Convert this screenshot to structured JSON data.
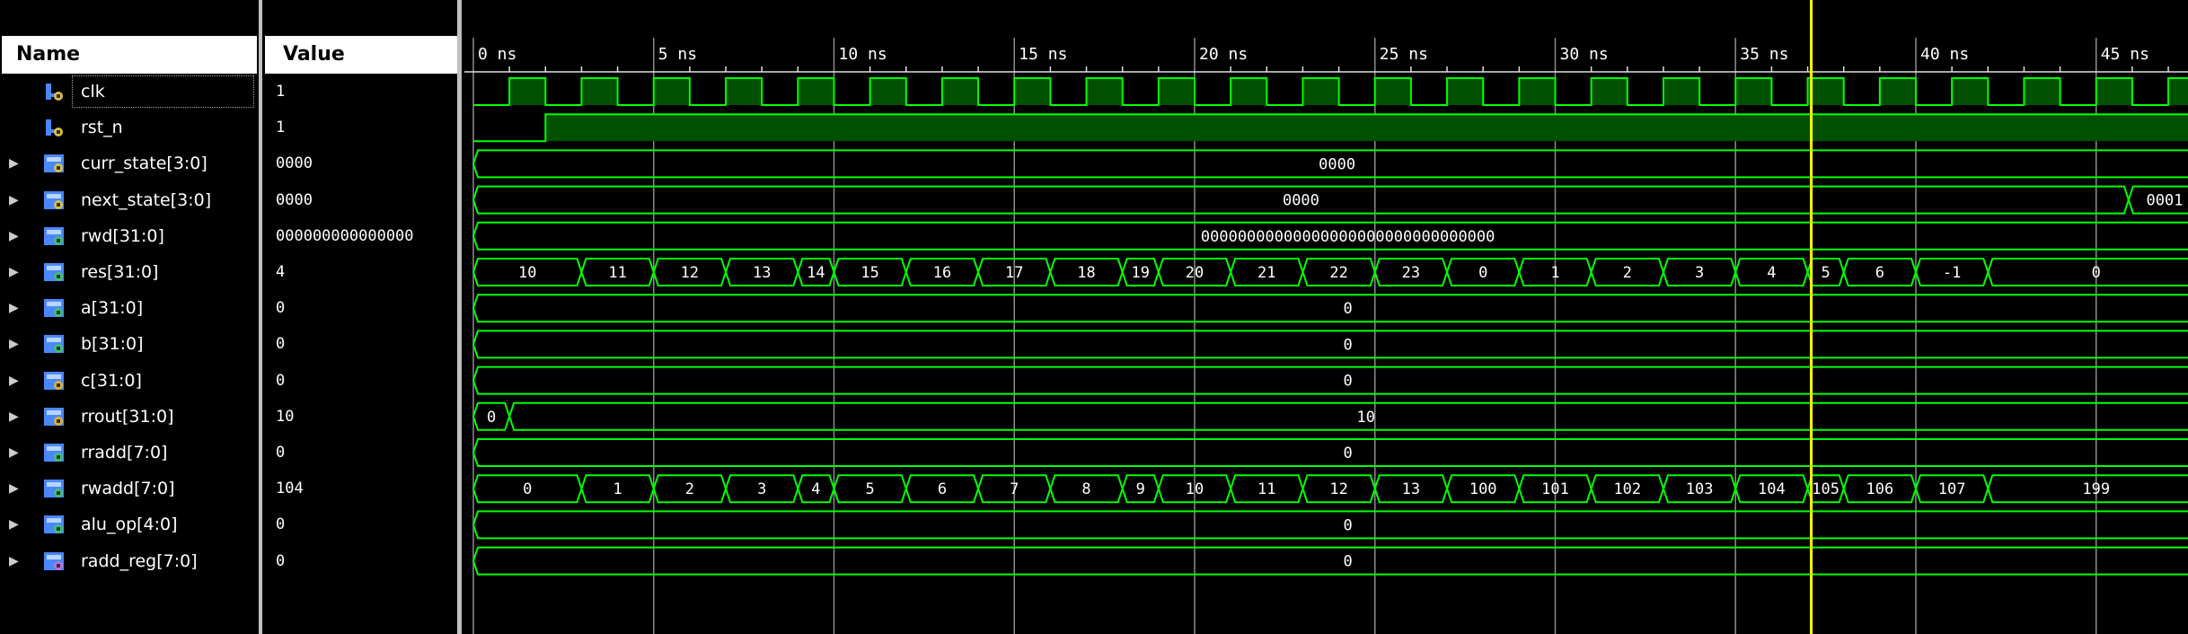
{
  "columns": {
    "name": "Name",
    "value": "Value"
  },
  "colors": {
    "wave": "#00ff00",
    "fill": "#005000",
    "cursor": "#ffff00",
    "grid": "#8c8c8c",
    "background": "#000000"
  },
  "timeline": {
    "ticks": [
      {
        "t": 0,
        "label": "0 ns"
      },
      {
        "t": 5,
        "label": "5 ns"
      },
      {
        "t": 10,
        "label": "10 ns"
      },
      {
        "t": 15,
        "label": "15 ns"
      },
      {
        "t": 20,
        "label": "20 ns"
      },
      {
        "t": 25,
        "label": "25 ns"
      },
      {
        "t": 30,
        "label": "30 ns"
      },
      {
        "t": 35,
        "label": "35 ns"
      },
      {
        "t": 40,
        "label": "40 ns"
      },
      {
        "t": 45,
        "label": "45 ns"
      }
    ],
    "cursor_ns": 37.1
  },
  "signals": [
    {
      "name": "clk",
      "value": "1",
      "kind": "clock",
      "icon": "input-bit-icon",
      "expandable": false,
      "clock": {
        "first_rise": 1,
        "high": 1,
        "low": 1
      }
    },
    {
      "name": "rst_n",
      "value": "1",
      "kind": "bit",
      "icon": "input-bit-icon",
      "expandable": false,
      "edges": [
        {
          "t": 0,
          "v": 0
        },
        {
          "t": 2,
          "v": 1
        }
      ]
    },
    {
      "name": "curr_state[3:0]",
      "value": "0000",
      "kind": "bus",
      "icon": "input-bus-icon",
      "expandable": true,
      "segments": [
        {
          "t0": 0,
          "t1": 47.9,
          "label": "0000"
        }
      ]
    },
    {
      "name": "next_state[3:0]",
      "value": "0000",
      "kind": "bus",
      "icon": "input-bus-icon",
      "expandable": true,
      "segments": [
        {
          "t0": 0,
          "t1": 45.9,
          "label": "0000"
        },
        {
          "t0": 45.9,
          "t1": 47.9,
          "label": "0001"
        }
      ]
    },
    {
      "name": "rwd[31:0]",
      "value": "000000000000000",
      "kind": "bus",
      "icon": "output-bus-icon",
      "expandable": true,
      "segments": [
        {
          "t0": 0,
          "t1": 48.5,
          "label": "00000000000000000000000000000000"
        }
      ]
    },
    {
      "name": "res[31:0]",
      "value": "4",
      "kind": "bus",
      "icon": "output-bus-icon",
      "expandable": true,
      "segments": [
        {
          "t0": 0,
          "t1": 3,
          "label": "10"
        },
        {
          "t0": 3,
          "t1": 5,
          "label": "11"
        },
        {
          "t0": 5,
          "t1": 7,
          "label": "12"
        },
        {
          "t0": 7,
          "t1": 9,
          "label": "13"
        },
        {
          "t0": 9,
          "t1": 10,
          "label": "14"
        },
        {
          "t0": 10,
          "t1": 12,
          "label": "15"
        },
        {
          "t0": 12,
          "t1": 14,
          "label": "16"
        },
        {
          "t0": 14,
          "t1": 16,
          "label": "17"
        },
        {
          "t0": 16,
          "t1": 18,
          "label": "18"
        },
        {
          "t0": 18,
          "t1": 19,
          "label": "19"
        },
        {
          "t0": 19,
          "t1": 21,
          "label": "20"
        },
        {
          "t0": 21,
          "t1": 23,
          "label": "21"
        },
        {
          "t0": 23,
          "t1": 25,
          "label": "22"
        },
        {
          "t0": 25,
          "t1": 27,
          "label": "23"
        },
        {
          "t0": 27,
          "t1": 29,
          "label": "0"
        },
        {
          "t0": 29,
          "t1": 31,
          "label": "1"
        },
        {
          "t0": 31,
          "t1": 33,
          "label": "2"
        },
        {
          "t0": 33,
          "t1": 35,
          "label": "3"
        },
        {
          "t0": 35,
          "t1": 37,
          "label": "4"
        },
        {
          "t0": 37,
          "t1": 38,
          "label": "5"
        },
        {
          "t0": 38,
          "t1": 40,
          "label": "6"
        },
        {
          "t0": 40,
          "t1": 42,
          "label": "-1"
        },
        {
          "t0": 42,
          "t1": 48,
          "label": "0"
        }
      ]
    },
    {
      "name": "a[31:0]",
      "value": "0",
      "kind": "bus",
      "icon": "output-bus-icon",
      "expandable": true,
      "segments": [
        {
          "t0": 0,
          "t1": 48.5,
          "label": "0"
        }
      ]
    },
    {
      "name": "b[31:0]",
      "value": "0",
      "kind": "bus",
      "icon": "output-bus-icon",
      "expandable": true,
      "segments": [
        {
          "t0": 0,
          "t1": 48.5,
          "label": "0"
        }
      ]
    },
    {
      "name": "c[31:0]",
      "value": "0",
      "kind": "bus",
      "icon": "internal-bus-icon",
      "expandable": true,
      "segments": [
        {
          "t0": 0,
          "t1": 48.5,
          "label": "0"
        }
      ]
    },
    {
      "name": "rrout[31:0]",
      "value": "10",
      "kind": "bus",
      "icon": "internal-bus-icon",
      "expandable": true,
      "segments": [
        {
          "t0": 0,
          "t1": 1,
          "label": "0"
        },
        {
          "t0": 1,
          "t1": 48.5,
          "label": "10"
        }
      ]
    },
    {
      "name": "rradd[7:0]",
      "value": "0",
      "kind": "bus",
      "icon": "output-bus-icon",
      "expandable": true,
      "segments": [
        {
          "t0": 0,
          "t1": 48.5,
          "label": "0"
        }
      ]
    },
    {
      "name": "rwadd[7:0]",
      "value": "104",
      "kind": "bus",
      "icon": "output-bus-icon",
      "expandable": true,
      "segments": [
        {
          "t0": 0,
          "t1": 3,
          "label": "0"
        },
        {
          "t0": 3,
          "t1": 5,
          "label": "1"
        },
        {
          "t0": 5,
          "t1": 7,
          "label": "2"
        },
        {
          "t0": 7,
          "t1": 9,
          "label": "3"
        },
        {
          "t0": 9,
          "t1": 10,
          "label": "4"
        },
        {
          "t0": 10,
          "t1": 12,
          "label": "5"
        },
        {
          "t0": 12,
          "t1": 14,
          "label": "6"
        },
        {
          "t0": 14,
          "t1": 16,
          "label": "7"
        },
        {
          "t0": 16,
          "t1": 18,
          "label": "8"
        },
        {
          "t0": 18,
          "t1": 19,
          "label": "9"
        },
        {
          "t0": 19,
          "t1": 21,
          "label": "10"
        },
        {
          "t0": 21,
          "t1": 23,
          "label": "11"
        },
        {
          "t0": 23,
          "t1": 25,
          "label": "12"
        },
        {
          "t0": 25,
          "t1": 27,
          "label": "13"
        },
        {
          "t0": 27,
          "t1": 29,
          "label": "100"
        },
        {
          "t0": 29,
          "t1": 31,
          "label": "101"
        },
        {
          "t0": 31,
          "t1": 33,
          "label": "102"
        },
        {
          "t0": 33,
          "t1": 35,
          "label": "103"
        },
        {
          "t0": 35,
          "t1": 37,
          "label": "104"
        },
        {
          "t0": 37,
          "t1": 38,
          "label": "105"
        },
        {
          "t0": 38,
          "t1": 40,
          "label": "106"
        },
        {
          "t0": 40,
          "t1": 42,
          "label": "107"
        },
        {
          "t0": 42,
          "t1": 48,
          "label": "199"
        }
      ]
    },
    {
      "name": "alu_op[4:0]",
      "value": "0",
      "kind": "bus",
      "icon": "output-bus-icon",
      "expandable": true,
      "segments": [
        {
          "t0": 0,
          "t1": 48.5,
          "label": "0"
        }
      ]
    },
    {
      "name": "radd_reg[7:0]",
      "value": "0",
      "kind": "bus",
      "icon": "register-bus-icon",
      "expandable": true,
      "segments": [
        {
          "t0": 0,
          "t1": 48.5,
          "label": "0"
        }
      ]
    }
  ]
}
